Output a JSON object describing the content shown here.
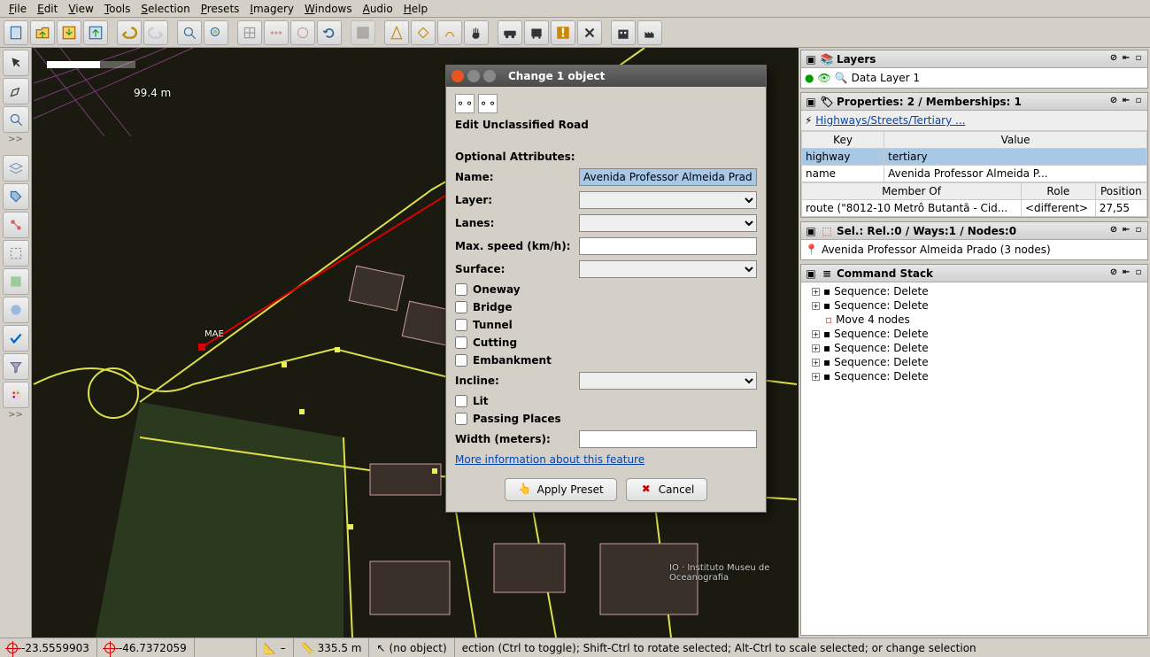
{
  "menubar": [
    "File",
    "Edit",
    "View",
    "Tools",
    "Selection",
    "Presets",
    "Imagery",
    "Windows",
    "Audio",
    "Help"
  ],
  "toolbar_names": [
    "new",
    "open",
    "save",
    "upload",
    "undo",
    "redo",
    "zoom-in",
    "zoom-out",
    "wireframe",
    "align",
    "split",
    "combine",
    "refresh",
    "download-imagery",
    "preset-road",
    "preset-cycle",
    "preset-foot",
    "hand",
    "car",
    "bus",
    "traffic-sign",
    "warning",
    "crossing",
    "building",
    "industry"
  ],
  "left_tools": {
    "group1": [
      "select",
      "draw",
      "zoom"
    ],
    "overflow1": ">>",
    "group2": [
      "layers",
      "tags",
      "relations",
      "validate",
      "history",
      "filter",
      "audio",
      "palette"
    ],
    "overflow2": ">>"
  },
  "map": {
    "dist": "99.4 m",
    "mae": "MAE",
    "label": "IO · Instituto    Museu de Oceanografia"
  },
  "dialog": {
    "title": "Change 1 object",
    "heading": "Edit Unclassified Road",
    "section": "Optional Attributes:",
    "fields": {
      "name_label": "Name:",
      "name_value": "Avenida Professor Almeida Prado",
      "layer_label": "Layer:",
      "lanes_label": "Lanes:",
      "maxspeed_label": "Max. speed (km/h):",
      "surface_label": "Surface:",
      "incline_label": "Incline:",
      "width_label": "Width (meters):"
    },
    "checks": {
      "oneway": "Oneway",
      "bridge": "Bridge",
      "tunnel": "Tunnel",
      "cutting": "Cutting",
      "embankment": "Embankment",
      "lit": "Lit",
      "passing": "Passing Places"
    },
    "link": "More information about this feature",
    "apply": "Apply Preset",
    "cancel": "Cancel"
  },
  "layers_panel": {
    "title": "Layers",
    "items": [
      "Data Layer 1"
    ]
  },
  "props_panel": {
    "title": "Properties: 2 / Memberships: 1",
    "tab": "Highways/Streets/Tertiary ...",
    "cols": {
      "key": "Key",
      "value": "Value"
    },
    "rows": [
      {
        "k": "highway",
        "v": "tertiary"
      },
      {
        "k": "name",
        "v": "Avenida Professor Almeida P..."
      }
    ],
    "member_cols": {
      "m": "Member Of",
      "r": "Role",
      "p": "Position"
    },
    "member_rows": [
      {
        "m": "route (\"8012-10 Metrô Butantã - Cid...",
        "r": "<different>",
        "p": "27,55"
      }
    ]
  },
  "sel_panel": {
    "title": "Sel.: Rel.:0 / Ways:1 / Nodes:0",
    "item": "Avenida Professor Almeida Prado (3 nodes)"
  },
  "cmd_panel": {
    "title": "Command Stack",
    "items": [
      "Sequence: Delete",
      "Sequence: Delete",
      "Move 4 nodes",
      "Sequence: Delete",
      "Sequence: Delete",
      "Sequence: Delete",
      "Sequence: Delete"
    ]
  },
  "status": {
    "lat": "-23.5559903",
    "lon": "-46.7372059",
    "angle": "–",
    "dist": "335.5 m",
    "obj_label": "(no object)",
    "help": "ection (Ctrl to toggle); Shift-Ctrl to rotate selected; Alt-Ctrl to scale selected; or change selection"
  }
}
